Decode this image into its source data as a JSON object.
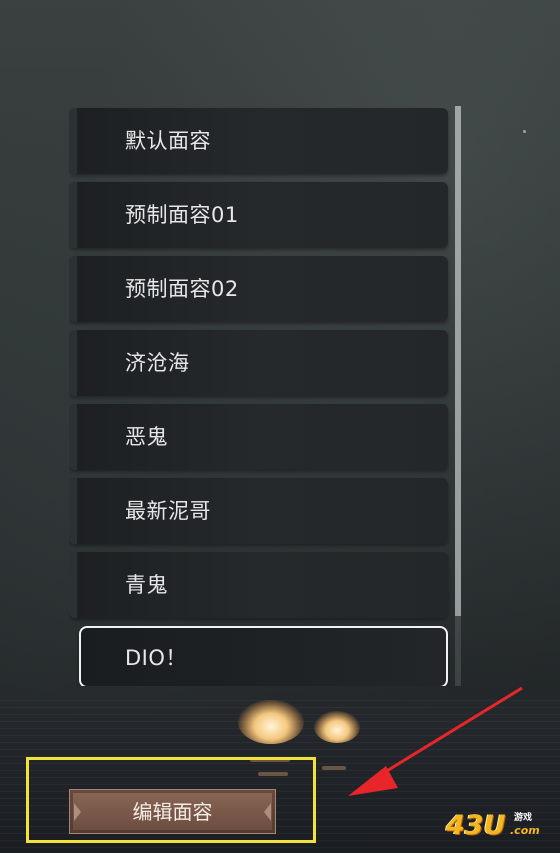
{
  "face_list": {
    "items": [
      {
        "label": "默认面容",
        "selected": false
      },
      {
        "label": "预制面容01",
        "selected": false
      },
      {
        "label": "预制面容02",
        "selected": false
      },
      {
        "label": "济沧海",
        "selected": false
      },
      {
        "label": "恶鬼",
        "selected": false
      },
      {
        "label": "最新泥哥",
        "selected": false
      },
      {
        "label": "青鬼",
        "selected": false
      },
      {
        "label": "DIO！",
        "selected": true
      }
    ]
  },
  "edit_button": {
    "label": "编辑面容"
  },
  "annotation": {
    "highlight_color": "#f2e23a",
    "arrow_color": "#e8262a"
  },
  "watermark": {
    "text": "43U",
    "sub": "游戏",
    "domain": ".com"
  },
  "colors": {
    "item_bg": "#23272a",
    "text": "#e6e8e8",
    "button_bg": "#7a594a",
    "watermark": "#f2b81e"
  }
}
